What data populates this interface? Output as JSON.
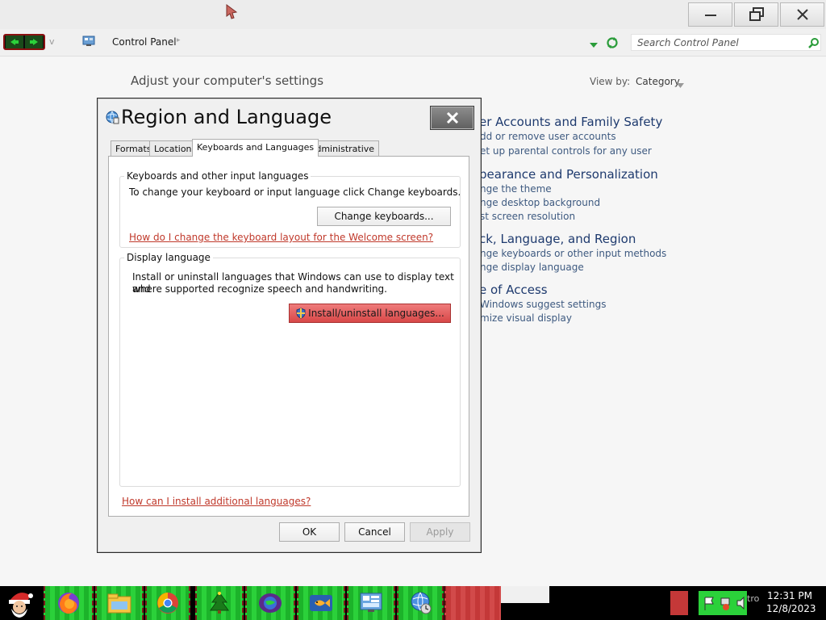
{
  "window": {
    "minimize_label": "minimize",
    "maximize_label": "restore",
    "close_label": "close"
  },
  "addressbar": {
    "crumb": "Control Panel",
    "nav_dropdown": "v",
    "search_placeholder": "Search Control Panel"
  },
  "control_panel": {
    "heading": "Adjust your computer's settings",
    "viewby_label": "View by:",
    "viewby_value": "Category",
    "categories": [
      {
        "title": "er Accounts and Family Safety",
        "links": [
          "dd or remove user accounts",
          "et up parental controls for any user"
        ]
      },
      {
        "title": "pearance and Personalization",
        "links": [
          "nge the theme",
          "nge desktop background",
          "st screen resolution"
        ]
      },
      {
        "title": "ck, Language, and Region",
        "links": [
          "nge keyboards or other input methods",
          "nge display language"
        ]
      },
      {
        "title": "e of Access",
        "links": [
          "Windows suggest settings",
          "mize visual display"
        ]
      }
    ]
  },
  "dialog": {
    "title": "Region and Language",
    "tabs": [
      "Formats",
      "Location",
      "Keyboards and Languages",
      "Administrative"
    ],
    "keyboards": {
      "group_label": "Keyboards and other input languages",
      "description": "To change your keyboard or input language click Change keyboards.",
      "button": "Change keyboards...",
      "link": "How do I change the keyboard layout for the Welcome screen?"
    },
    "display": {
      "group_label": "Display language",
      "description_line1": "Install or uninstall languages that Windows can use to display text and",
      "description_line2": "where supported recognize speech and handwriting.",
      "button": "Install/uninstall languages..."
    },
    "bottom_link": "How can I install additional languages?",
    "ok": "OK",
    "cancel": "Cancel",
    "apply": "Apply"
  },
  "taskbar": {
    "items": [
      "firefox",
      "file-explorer",
      "chrome",
      "tree-app",
      "globe-app",
      "fish-app",
      "control-panel-app",
      "network-globe-app"
    ],
    "tray_label": "tro",
    "clock_time": "12:31 PM",
    "clock_date": "12/8/2023"
  },
  "colors": {
    "link_red": "#c0392b",
    "install_button": "#e05a5a",
    "category_blue": "#1e3a6e",
    "taskbar_green": "#2bd13a"
  }
}
